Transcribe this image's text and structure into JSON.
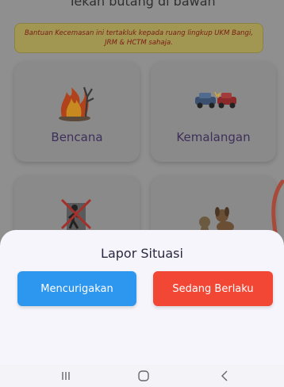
{
  "header": {
    "text": "Tekan butang di bawah"
  },
  "notice": {
    "text": "Bantuan Kecemasan ini tertakluk kepada ruang lingkup UKM Bangi, JRM & HCTM sahaja."
  },
  "cards": [
    {
      "label": "Bencana",
      "icon": "fire-tree-icon"
    },
    {
      "label": "Kemalangan",
      "icon": "car-crash-icon"
    },
    {
      "label": "",
      "icon": "no-entry-person-icon"
    },
    {
      "label": "",
      "icon": "animals-icon"
    }
  ],
  "sheet": {
    "title": "Lapor Situasi",
    "buttons": [
      {
        "label": "Mencurigakan",
        "color": "#2d96ef"
      },
      {
        "label": "Sedang Berlaku",
        "color": "#f24735"
      }
    ]
  },
  "navbar": {
    "icons": [
      "recent-apps-icon",
      "home-icon",
      "back-icon"
    ]
  }
}
